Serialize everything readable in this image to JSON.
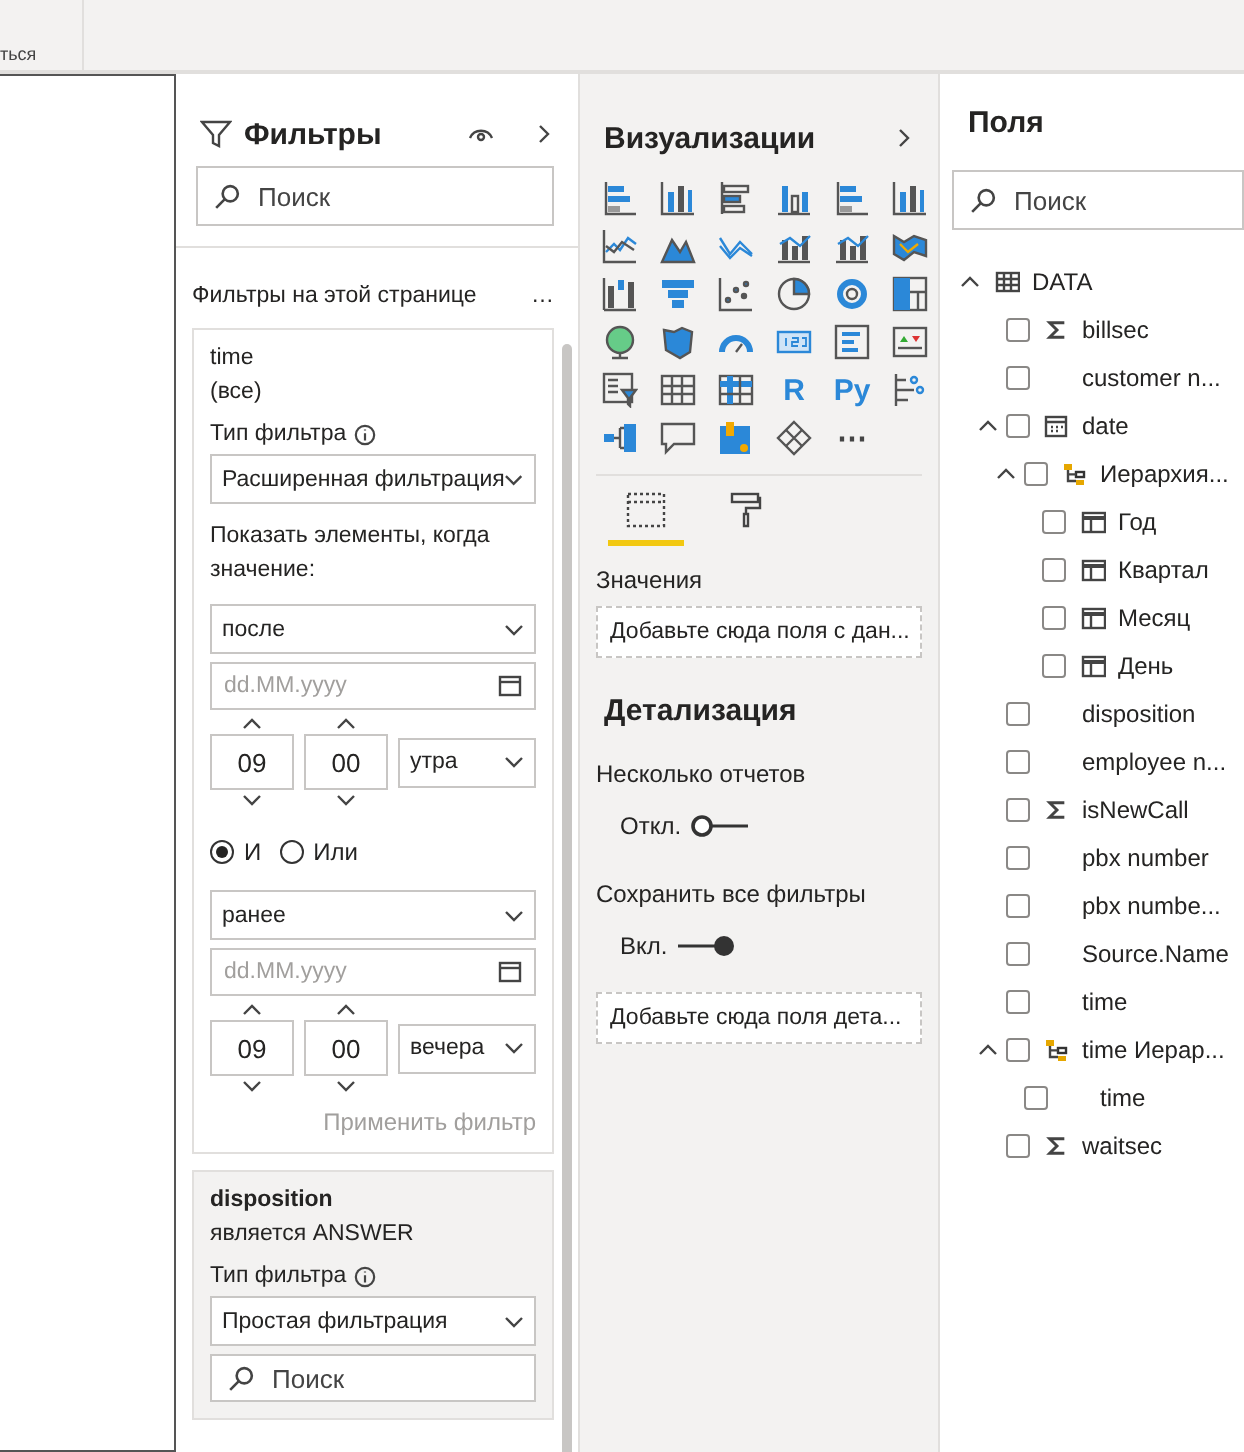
{
  "ribbon": {
    "label": "ться"
  },
  "filters": {
    "title": "Фильтры",
    "search": {
      "placeholder": "Поиск"
    },
    "section": "Фильтры на этой странице",
    "more": "…",
    "cards": [
      {
        "kind": "advanced",
        "field": "time",
        "summary": "(все)",
        "type_label": "Тип фильтра",
        "type_value": "Расширенная фильтрация",
        "show_label": "Показать элементы, когда значение:",
        "conditions": [
          {
            "op": "после",
            "date_placeholder": "dd.MM.yyyy",
            "hour": "09",
            "minute": "00",
            "period": "утра"
          },
          {
            "op": "ранее",
            "date_placeholder": "dd.MM.yyyy",
            "hour": "09",
            "minute": "00",
            "period": "вечера"
          }
        ],
        "logic": [
          {
            "label": "И",
            "selected": true
          },
          {
            "label": "Или",
            "selected": false
          }
        ],
        "apply": "Применить фильтр"
      },
      {
        "kind": "basic",
        "field": "disposition",
        "summary": "является ANSWER",
        "type_label": "Тип фильтра",
        "type_value": "Простая фильтрация",
        "search": {
          "placeholder": "Поиск"
        }
      }
    ]
  },
  "visualizations": {
    "title": "Визуализации",
    "icons": [
      {
        "kind": "hbar-stacked"
      },
      {
        "kind": "vbar-stacked"
      },
      {
        "kind": "hbar"
      },
      {
        "kind": "vbar"
      },
      {
        "kind": "hbar-stacked"
      },
      {
        "kind": "vbar-stacked"
      },
      {
        "kind": "line"
      },
      {
        "kind": "area"
      },
      {
        "kind": "area-line"
      },
      {
        "kind": "combo"
      },
      {
        "kind": "combo"
      },
      {
        "kind": "ribbon"
      },
      {
        "kind": "waterfall"
      },
      {
        "kind": "funnel"
      },
      {
        "kind": "scatter"
      },
      {
        "kind": "pie"
      },
      {
        "kind": "donut"
      },
      {
        "kind": "treemap"
      },
      {
        "kind": "globe"
      },
      {
        "kind": "map"
      },
      {
        "kind": "gauge"
      },
      {
        "kind": "card"
      },
      {
        "kind": "multirow"
      },
      {
        "kind": "kpi"
      },
      {
        "kind": "slicer"
      },
      {
        "kind": "table"
      },
      {
        "kind": "matrix"
      },
      {
        "kind": "text",
        "label": "R"
      },
      {
        "kind": "text",
        "label": "Py"
      },
      {
        "kind": "influencers"
      },
      {
        "kind": "tree"
      },
      {
        "kind": "speech"
      },
      {
        "kind": "shape-map"
      },
      {
        "kind": "diamond"
      },
      {
        "kind": "more",
        "label": "⋯"
      }
    ],
    "tabs": [
      {
        "kind": "fields",
        "selected": true
      },
      {
        "kind": "format",
        "selected": false
      }
    ],
    "values_label": "Значения",
    "values_drop": "Добавьте сюда поля с дан...",
    "drill_title": "Детализация",
    "toggles": [
      {
        "label": "Несколько отчетов",
        "state": "Откл.",
        "on": false
      },
      {
        "label": "Сохранить все фильтры",
        "state": "Вкл.",
        "on": true
      }
    ],
    "drill_drop": "Добавьте сюда поля дета..."
  },
  "fields": {
    "title": "Поля",
    "search": {
      "placeholder": "Поиск"
    },
    "tree": [
      {
        "kind": "table",
        "label": "DATA",
        "expanded": true,
        "children": [
          {
            "kind": "measure",
            "label": "billsec",
            "checked": false
          },
          {
            "kind": "plain",
            "label": "customer n...",
            "checked": false
          },
          {
            "kind": "calendar",
            "label": "date",
            "checked": false,
            "expanded": true,
            "children": [
              {
                "kind": "hierarchy",
                "label": "Иерархия...",
                "checked": false,
                "expanded": true,
                "children": [
                  {
                    "kind": "date-part",
                    "label": "Год",
                    "checked": false
                  },
                  {
                    "kind": "date-part",
                    "label": "Квартал",
                    "checked": false
                  },
                  {
                    "kind": "date-part",
                    "label": "Месяц",
                    "checked": false
                  },
                  {
                    "kind": "date-part",
                    "label": "День",
                    "checked": false
                  }
                ]
              }
            ]
          },
          {
            "kind": "plain",
            "label": "disposition",
            "checked": false
          },
          {
            "kind": "plain",
            "label": "employee n...",
            "checked": false
          },
          {
            "kind": "measure",
            "label": "isNewCall",
            "checked": false
          },
          {
            "kind": "plain",
            "label": "pbx number",
            "checked": false
          },
          {
            "kind": "plain",
            "label": "pbx numbe...",
            "checked": false
          },
          {
            "kind": "plain",
            "label": "Source.Name",
            "checked": false
          },
          {
            "kind": "plain",
            "label": "time",
            "checked": false
          },
          {
            "kind": "hierarchy",
            "label": "time Иерар...",
            "checked": false,
            "expanded": true,
            "children": [
              {
                "kind": "plain",
                "label": "time",
                "checked": false
              }
            ]
          },
          {
            "kind": "measure",
            "label": "waitsec",
            "checked": false
          }
        ]
      }
    ]
  }
}
